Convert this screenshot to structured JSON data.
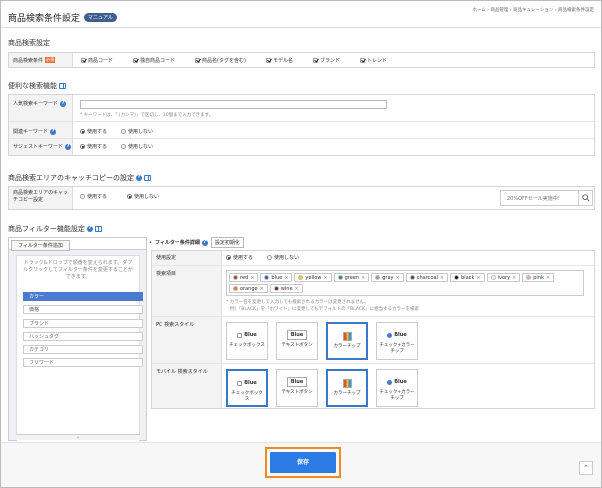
{
  "page": {
    "title": "商品検索条件設定",
    "manual_label": "マニュアル",
    "breadcrumb": "ホーム › 商品管理 › 商品キュレーション › 商品検索条件設定"
  },
  "search_section": {
    "heading": "商品検索設定",
    "row_label": "商品検索条件",
    "badge": "必須",
    "options": [
      {
        "label": "商品コード",
        "checked": true
      },
      {
        "label": "独自商品コード",
        "checked": true
      },
      {
        "label": "商品名(タグを含む)",
        "checked": true
      },
      {
        "label": "モデル名",
        "checked": true
      },
      {
        "label": "ブランド",
        "checked": true
      },
      {
        "label": "トレンド",
        "checked": true
      }
    ]
  },
  "useful_section": {
    "heading": "便利な検索機能",
    "popular_label": "人気検索キーワード",
    "popular_value": "",
    "popular_hint": "* キーワードは、「,(カンマ)」で区切し、10個まで入力できます。",
    "related_label": "関連キーワード",
    "suggest_label": "サジェストキーワード",
    "use": "使用する",
    "nouse": "使用しない"
  },
  "catch_section": {
    "heading": "商品検索エリアのキャッチコピーの設定",
    "row_label": "商品検索エリアのキャッチコピー設定",
    "use": "使用する",
    "nouse": "使用しない",
    "preview_placeholder": "20%OFFセール実施中!"
  },
  "filter_section": {
    "heading": "商品フィルター機能設定",
    "add_tab": "フィルター条件追加",
    "drag_hint": "ドラッグ&ドロップで順番を変えられます。ダブルクリックしてフィルター条件を変更することができます。",
    "items": [
      "カラー",
      "価格",
      "ブランド",
      "ハッシュタグ",
      "カテゴリ",
      "フリワード"
    ],
    "detail_tab": "フィルター条件詳細",
    "reset_label": "設定初期化",
    "usage_label": "使用設定",
    "use": "使用する",
    "nouse": "使用しない",
    "search_label": "検索項目",
    "colors": [
      {
        "name": "red",
        "hex": "#c0392b"
      },
      {
        "name": "blue",
        "hex": "#2b59c3"
      },
      {
        "name": "yellow",
        "hex": "#f2d100"
      },
      {
        "name": "green",
        "hex": "#1e8f4e"
      },
      {
        "name": "gray",
        "hex": "#9a9a9a"
      },
      {
        "name": "charcoal",
        "hex": "#444444"
      },
      {
        "name": "black",
        "hex": "#111111"
      },
      {
        "name": "ivory",
        "hex": "#f7f3e4"
      },
      {
        "name": "pink",
        "hex": "#f5a6c0"
      },
      {
        "name": "orange",
        "hex": "#ef7d1a"
      },
      {
        "name": "wine",
        "hex": "#7b1b2c"
      }
    ],
    "note1": "* カラー名を変更して入力しても検索されるカラーは変更されません。",
    "note2": "例）「BLACK」を「ホワイト」に変更してもデフォルトの「BLACK」に相当するカラーを検索",
    "pc_label": "PC 検索スタイル",
    "mobile_label": "モバイル 検索スタイル",
    "styles": [
      "チェックボックス",
      "テキストボタン",
      "カラーチップ",
      "チェック+カラーチップ"
    ],
    "blue_text": "Blue"
  },
  "save_label": "保存",
  "accent": "#2c7be5"
}
